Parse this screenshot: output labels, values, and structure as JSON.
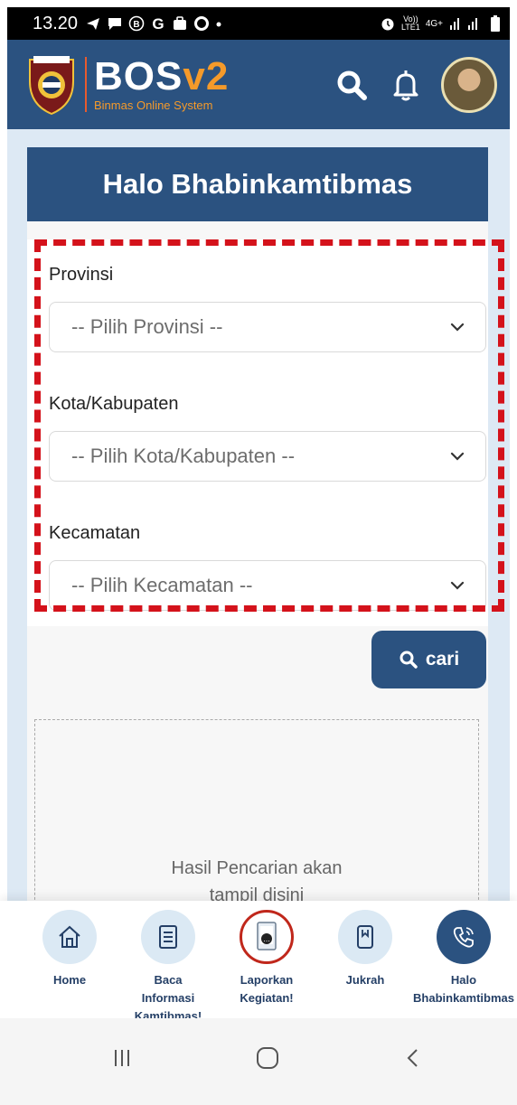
{
  "status_bar": {
    "time": "13.20",
    "volte_line1": "Vo))",
    "volte_line2": "LTE1",
    "network": "4G+"
  },
  "header": {
    "app_title": "BOS",
    "app_title_suffix": "v2",
    "app_subtitle": "Binmas Online System"
  },
  "greeting": "Halo Bhabinkamtibmas",
  "form": {
    "provinsi_label": "Provinsi",
    "provinsi_placeholder": "-- Pilih Provinsi --",
    "kota_label": "Kota/Kabupaten",
    "kota_placeholder": "-- Pilih Kota/Kabupaten --",
    "kecamatan_label": "Kecamatan",
    "kecamatan_placeholder": "-- Pilih Kecamatan --",
    "search_button": "cari"
  },
  "result_placeholder_line1": "Hasil Pencarian akan",
  "result_placeholder_line2": "tampil disini",
  "bottom_nav": [
    {
      "label_line1": "Home",
      "label_line2": "",
      "label_line3": "",
      "icon": "home-icon"
    },
    {
      "label_line1": "Baca",
      "label_line2": "Informasi",
      "label_line3": "Kamtibmas!",
      "icon": "document-icon"
    },
    {
      "label_line1": "Laporkan",
      "label_line2": "Kegiatan!",
      "label_line3": "",
      "icon": "report-icon"
    },
    {
      "label_line1": "Jukrah",
      "label_line2": "",
      "label_line3": "",
      "icon": "book-icon"
    },
    {
      "label_line1": "Halo",
      "label_line2": "Bhabinkamtibmas",
      "label_line3": "",
      "icon": "phone-icon"
    }
  ],
  "colors": {
    "primary": "#2b5280",
    "accent": "#f59a2a",
    "highlight_dash": "#d4121b"
  }
}
